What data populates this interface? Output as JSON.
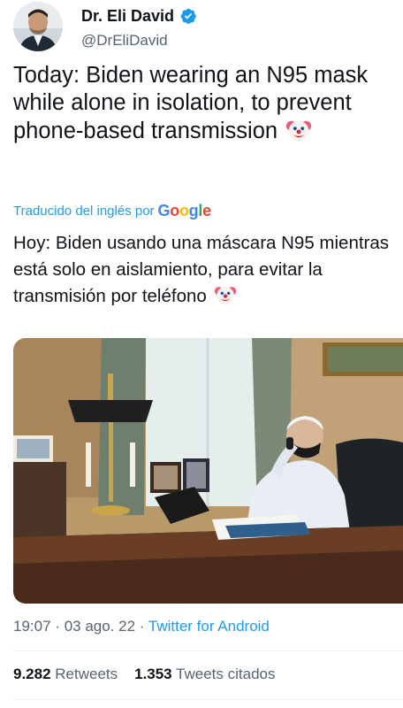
{
  "author": {
    "display_name": "Dr. Eli David",
    "handle": "@DrEliDavid",
    "verified_icon": "verified-badge-icon"
  },
  "tweet": {
    "text": "Today: Biden wearing an N95 mask while alone in isolation, to prevent phone-based transmission",
    "emoji": "clown-face-icon"
  },
  "translation": {
    "label": "Traducido del inglés por",
    "provider_logo": "Google",
    "text": "Hoy: Biden usando una máscara N95 mientras está solo en aislamiento, para evitar la transmisión por teléfono"
  },
  "media": {
    "icon": "photo-biden-desk"
  },
  "meta": {
    "time": "19:07",
    "separator": "·",
    "date": "03 ago. 22",
    "source": "Twitter for Android"
  },
  "stats": {
    "retweets_count": "9.282",
    "retweets_label": "Retweets",
    "quotes_count": "1.353",
    "quotes_label": "Tweets citados"
  },
  "colors": {
    "accent": "#1d9bf0",
    "text": "#0f1419",
    "secondary": "#536471"
  }
}
